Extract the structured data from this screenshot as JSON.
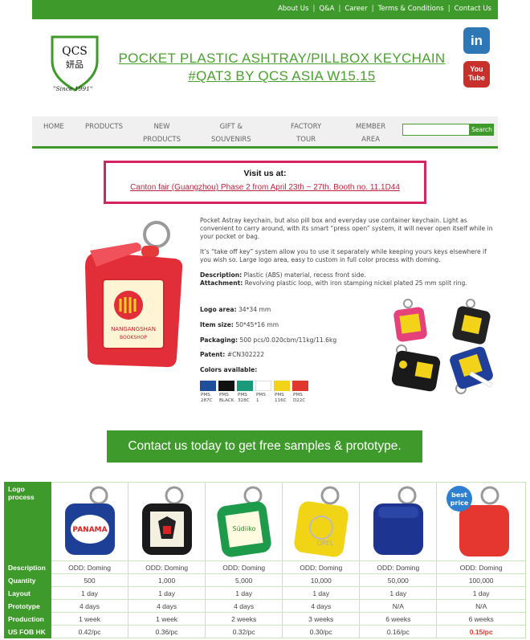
{
  "top_nav": {
    "links": [
      "About Us",
      "Q&A",
      "Career",
      "Terms & Conditions",
      "Contact Us"
    ]
  },
  "brand": {
    "logo_text": "QCS",
    "logo_chinese": "妍品",
    "since": "\"Since 1991\""
  },
  "page_title_line1": "POCKET PLASTIC ASHTRAY/PILLBOX KEYCHAIN",
  "page_title_line2": "#QAT3 BY QCS ASIA W15.15",
  "social": {
    "linkedin": "in",
    "youtube_1": "You",
    "youtube_2": "Tube"
  },
  "main_nav": {
    "home": "HOME",
    "products": "PRODUCTS",
    "new_1": "NEW",
    "new_2": "PRODUCTS",
    "gift_1": "GIFT &",
    "gift_2": "SOUVENIRS",
    "factory_1": "FACTORY",
    "factory_2": "TOUR",
    "member_1": "MEMBER",
    "member_2": "AREA",
    "search_placeholder": "",
    "search_button": "Search"
  },
  "visit": {
    "title": "Visit us at:",
    "link": "Canton fair (Guangzhou) Phase 2 from April 23th ~ 27th. Booth no. 11.1D44"
  },
  "product_image_text": {
    "line1": "NANGANGSHAN",
    "line2": "BOOKSHOP"
  },
  "description": {
    "p1": "Pocket Astray keychain, but also pill box and everyday use container keychain. Light as convenient to carry around, with its smart “press open” system, it will never open itself while in your pocket or bag.",
    "p2": "It’s “take off key” system allow you to use it separately while keeping yours keys elsewhere if you wish so. Large logo area, easy to custom in full color process with doming.",
    "material_label": "Description:",
    "material_value": "Plastic (ABS) material, recess front side.",
    "attachment_label": "Attachment:",
    "attachment_value": "Revolving plastic loop, with iron stamping nickel plated 25 mm split ring."
  },
  "specs": {
    "logo_area_label": "Logo area:",
    "logo_area_value": "34*34 mm",
    "item_size_label": "Item size:",
    "item_size_value": "50*45*16 mm",
    "packaging_label": "Packaging:",
    "packaging_value": "500 pcs/0.020cbm/11kg/11.6kg",
    "patent_label": "Patent:",
    "patent_value": "#CN302222",
    "colors_label": "Colors available:"
  },
  "colors": [
    {
      "hex": "#1f4e9a",
      "l1": "PMS",
      "l2": "287C"
    },
    {
      "hex": "#111111",
      "l1": "PMS",
      "l2": "BLACK"
    },
    {
      "hex": "#1a9a7a",
      "l1": "PMS",
      "l2": "328C"
    },
    {
      "hex": "#ffffff",
      "l1": "PMS",
      "l2": "1"
    },
    {
      "hex": "#f3d21a",
      "l1": "PMS",
      "l2": "116C"
    },
    {
      "hex": "#e0382c",
      "l1": "PMS",
      "l2": "D22C"
    }
  ],
  "cta": "Contact us today to get free samples & prototype.",
  "table": {
    "logo_process": "Logo process",
    "images": [
      "PANAMA",
      "",
      "Súdiiko",
      "OPEL",
      "",
      ""
    ],
    "best_price_1": "best",
    "best_price_2": "price",
    "rows": [
      {
        "label": "Description",
        "cells": [
          "ODD: Doming",
          "ODD: Doming",
          "ODD: Doming",
          "ODD: Doming",
          "ODD: Doming",
          "ODD: Doming"
        ]
      },
      {
        "label": "Quantity",
        "cells": [
          "500",
          "1,000",
          "5,000",
          "10,000",
          "50,000",
          "100,000"
        ]
      },
      {
        "label": "Layout",
        "cells": [
          "1 day",
          "1 day",
          "1 day",
          "1 day",
          "1 day",
          "1 day"
        ]
      },
      {
        "label": "Prototype",
        "cells": [
          "4 days",
          "4 days",
          "4 days",
          "4 days",
          "N/A",
          "N/A"
        ]
      },
      {
        "label": "Production",
        "cells": [
          "1 week",
          "1 week",
          "2 weeks",
          "3 weeks",
          "6 weeks",
          "6 weeks"
        ]
      },
      {
        "label": "US FOB HK",
        "cells": [
          "0.42/pc",
          "0.36/pc",
          "0.32/pc",
          "0.30/pc",
          "0.16/pc",
          "0.15/pc"
        ]
      }
    ]
  }
}
